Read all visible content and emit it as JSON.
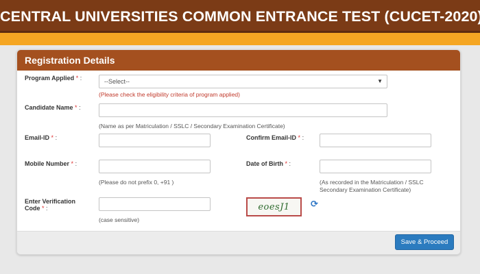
{
  "header": {
    "title": "CENTRAL UNIVERSITIES COMMON ENTRANCE TEST (CUCET-2020)"
  },
  "form": {
    "title": "Registration Details",
    "program": {
      "label": "Program Applied",
      "selected": "--Select--",
      "note": "(Please check the eligibility criteria of program applied)"
    },
    "candidate_name": {
      "label": "Candidate Name",
      "hint": "(Name as per Matriculation / SSLC / Secondary Examination Certificate)"
    },
    "email": {
      "label": "Email-ID"
    },
    "confirm_email": {
      "label": "Confirm Email-ID"
    },
    "mobile": {
      "label": "Mobile Number",
      "hint": "(Please do not prefix 0, +91 )"
    },
    "dob": {
      "label": "Date of Birth",
      "hint_line1": "(As recorded in the Matriculation / SSLC",
      "hint_line2": "Secondary Examination Certificate)"
    },
    "verification": {
      "label_line1": "Enter Verification",
      "label_line2": "Code",
      "hint": "(case sensitive)",
      "captcha_text": "eoesJ1"
    },
    "required_marker": "*",
    "separator": ":",
    "save_button": "Save & Proceed"
  },
  "colors": {
    "banner": "#7b3b16",
    "stripe": "#f5a623",
    "panel_header": "#a4501f",
    "button": "#2b7bbf",
    "required": "#d33333",
    "note_red": "#c0392b"
  }
}
